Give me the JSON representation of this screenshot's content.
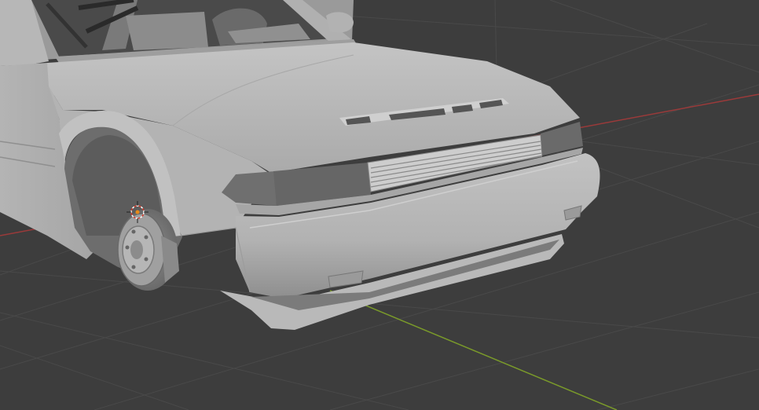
{
  "viewport": {
    "background_color": "#3d3d3d",
    "grid_color": "#484848",
    "x_axis_color": "#9a3a3a",
    "y_axis_color": "#7a9a2a",
    "model_base_color": "#b9b9b9",
    "model_shadow_color": "#8a8a8a",
    "model_dark_color": "#5f5f5f",
    "origin_icon": "object-origin-icon",
    "cursor_icon": "3d-cursor-icon"
  }
}
